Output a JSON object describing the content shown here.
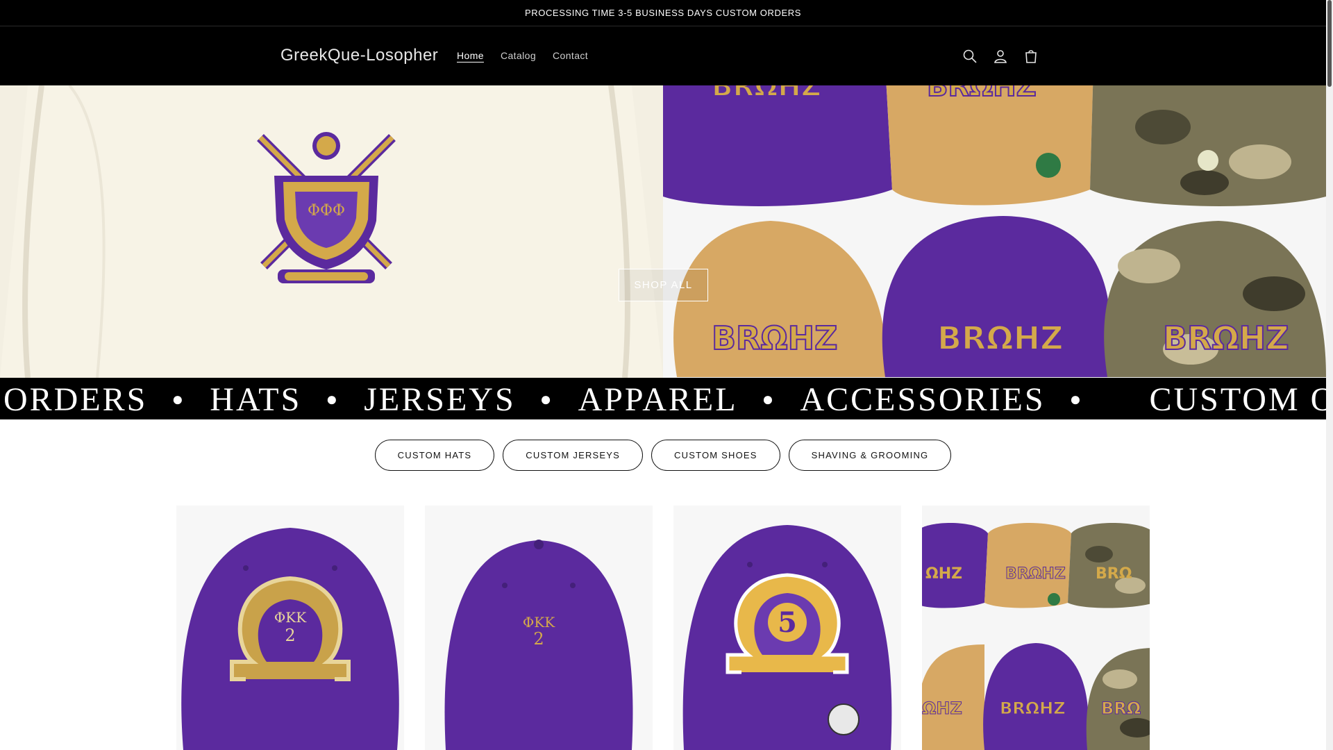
{
  "announcement": {
    "text": "PROCESSING TIME 3-5 BUSINESS DAYS CUSTOM ORDERS"
  },
  "header": {
    "logo": "GreekQue-Losopher",
    "nav": [
      {
        "label": "Home",
        "active": true
      },
      {
        "label": "Catalog",
        "active": false
      },
      {
        "label": "Contact",
        "active": false
      }
    ],
    "icons": [
      "search-icon",
      "account-icon",
      "cart-icon"
    ]
  },
  "hero": {
    "button_label": "SHOP ALL",
    "colors": {
      "purple": "#5b2a9e",
      "gold": "#d4a94a",
      "cream": "#ece9df"
    }
  },
  "marquee": {
    "items": [
      "ORDERS",
      "HATS",
      "JERSEYS",
      "APPAREL",
      "ACCESSORIES",
      "CUSTOM ORDE"
    ]
  },
  "collections": {
    "pills": [
      "CUSTOM HATS",
      "CUSTOM JERSEYS",
      "CUSTOM SHOES",
      "SHAVING & GROOMING"
    ]
  },
  "products": {
    "cards": [
      {
        "name": "product-card-omega-glitter-hat",
        "embroidery": "ΦKK",
        "number": "2"
      },
      {
        "name": "product-card-plain-purple-hat",
        "embroidery": "ΦKK",
        "number": "2"
      },
      {
        "name": "product-card-omega-5-hat",
        "number": "5"
      },
      {
        "name": "product-card-hat-collection"
      }
    ]
  }
}
